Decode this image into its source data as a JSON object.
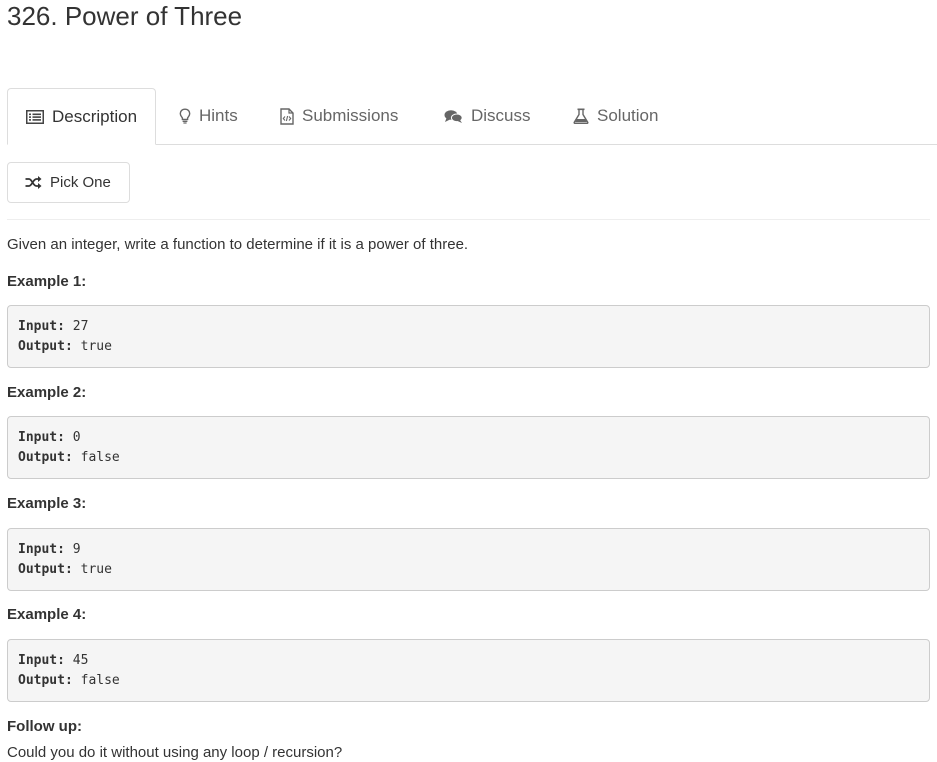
{
  "problem": {
    "title": "326. Power of Three"
  },
  "tabs": [
    {
      "label": "Description",
      "icon": "list-alt-icon"
    },
    {
      "label": "Hints",
      "icon": "lightbulb-icon"
    },
    {
      "label": "Submissions",
      "icon": "code-file-icon"
    },
    {
      "label": "Discuss",
      "icon": "comments-icon"
    },
    {
      "label": "Solution",
      "icon": "flask-icon"
    }
  ],
  "pick_button": {
    "label": "Pick One",
    "icon": "shuffle-icon"
  },
  "description": "Given an integer, write a function to determine if it is a power of three.",
  "examples": [
    {
      "label": "Example 1:",
      "input_key": "Input:",
      "input": "27",
      "output_key": "Output:",
      "output": "true"
    },
    {
      "label": "Example 2:",
      "input_key": "Input:",
      "input": "0",
      "output_key": "Output:",
      "output": "false"
    },
    {
      "label": "Example 3:",
      "input_key": "Input:",
      "input": "9",
      "output_key": "Output:",
      "output": "true"
    },
    {
      "label": "Example 4:",
      "input_key": "Input:",
      "input": "45",
      "output_key": "Output:",
      "output": "false"
    }
  ],
  "follow_up": {
    "label": "Follow up:",
    "text": "Could you do it without using any loop / recursion?"
  }
}
